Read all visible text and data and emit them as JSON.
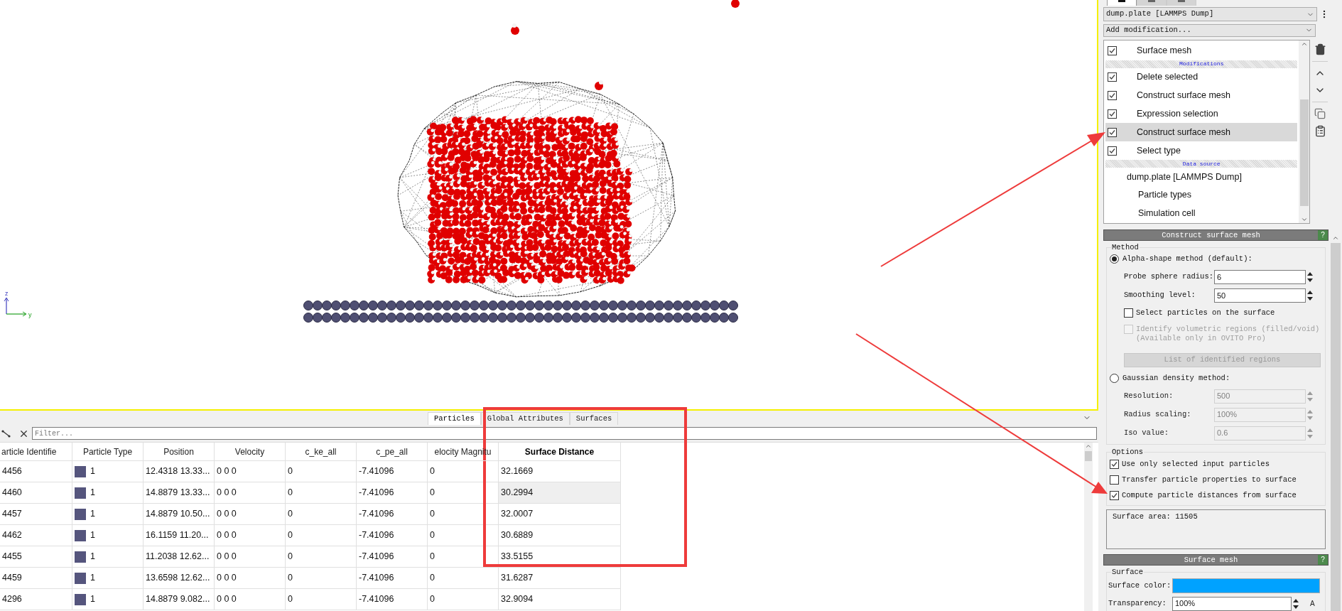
{
  "viewport": {
    "axis_labels": [
      "z",
      "y"
    ]
  },
  "data_inspector": {
    "tabs": [
      {
        "label": "Particles",
        "selected": true
      },
      {
        "label": "Global Attributes",
        "selected": false
      },
      {
        "label": "Surfaces",
        "selected": false
      }
    ],
    "filter": {
      "placeholder": "Filter..."
    },
    "table": {
      "columns": [
        {
          "label": "article Identifie",
          "selected": false
        },
        {
          "label": "Particle Type",
          "selected": false
        },
        {
          "label": "Position",
          "selected": false
        },
        {
          "label": "Velocity",
          "selected": false
        },
        {
          "label": "c_ke_all",
          "selected": false
        },
        {
          "label": "c_pe_all",
          "selected": false
        },
        {
          "label": "elocity Magnitu",
          "selected": false
        },
        {
          "label": "Surface Distance",
          "selected": true
        }
      ],
      "rows": [
        {
          "cells": [
            "4456",
            "1",
            "12.4318 13.33...",
            "0 0 0",
            "0",
            "-7.41096",
            "0",
            "32.1669"
          ],
          "color": "#55557d",
          "selected": false
        },
        {
          "cells": [
            "4460",
            "1",
            "14.8879 13.33...",
            "0 0 0",
            "0",
            "-7.41096",
            "0",
            "30.2994"
          ],
          "color": "#55557d",
          "selected": true
        },
        {
          "cells": [
            "4457",
            "1",
            "14.8879 10.50...",
            "0 0 0",
            "0",
            "-7.41096",
            "0",
            "32.0007"
          ],
          "color": "#55557d",
          "selected": false
        },
        {
          "cells": [
            "4462",
            "1",
            "16.1159 11.20...",
            "0 0 0",
            "0",
            "-7.41096",
            "0",
            "30.6889"
          ],
          "color": "#55557d",
          "selected": false
        },
        {
          "cells": [
            "4455",
            "1",
            "11.2038 12.62...",
            "0 0 0",
            "0",
            "-7.41096",
            "0",
            "33.5155"
          ],
          "color": "#55557d",
          "selected": false
        },
        {
          "cells": [
            "4459",
            "1",
            "13.6598 12.62...",
            "0 0 0",
            "0",
            "-7.41096",
            "0",
            "31.6287"
          ],
          "color": "#55557d",
          "selected": false
        },
        {
          "cells": [
            "4296",
            "1",
            "14.8879 9.082...",
            "0 0 0",
            "0",
            "-7.41096",
            "0",
            "32.9094"
          ],
          "color": "#55557d",
          "selected": false
        }
      ]
    }
  },
  "pipeline": {
    "top_tabs": [
      {
        "selected": true
      },
      {
        "selected": false
      },
      {
        "selected": false
      }
    ],
    "source_dropdown": "dump.plate [LAMMPS Dump]",
    "add_modification": "Add modification...",
    "items": [
      {
        "kind": "entry",
        "label": "Surface mesh",
        "checked": true,
        "selected": false
      },
      {
        "kind": "header",
        "label": "Modifications"
      },
      {
        "kind": "entry",
        "label": "Delete selected",
        "checked": true,
        "selected": false
      },
      {
        "kind": "entry",
        "label": "Construct surface mesh",
        "checked": true,
        "selected": false
      },
      {
        "kind": "entry",
        "label": "Expression selection",
        "checked": true,
        "selected": false
      },
      {
        "kind": "entry",
        "label": "Construct surface mesh",
        "checked": true,
        "selected": true
      },
      {
        "kind": "entry",
        "label": "Select type",
        "checked": true,
        "selected": false
      },
      {
        "kind": "header",
        "label": "Data source"
      },
      {
        "kind": "source",
        "label": "dump.plate [LAMMPS Dump]",
        "selected": false,
        "children": [
          {
            "label": "Particle types",
            "selected": false
          },
          {
            "label": "Simulation cell",
            "selected": false
          }
        ]
      }
    ]
  },
  "modifier_panel": {
    "title": "Construct surface mesh",
    "help": "?",
    "method": {
      "title": "Method",
      "options": [
        {
          "label": "Alpha-shape method (default):",
          "selected": true,
          "fields": [
            {
              "kind": "spinner",
              "label": "Probe sphere radius:",
              "value": "6",
              "disabled": false
            },
            {
              "kind": "spinner",
              "label": "Smoothing level:",
              "value": "50",
              "disabled": false
            },
            {
              "kind": "checkbox",
              "label": "Select particles on the surface",
              "checked": false,
              "disabled": false
            },
            {
              "kind": "checkbox",
              "label": "Identify volumetric regions (filled/void)\n(Available only in OVITO Pro)",
              "checked": false,
              "disabled": true
            },
            {
              "kind": "button",
              "label": "List of identified regions",
              "disabled": true
            }
          ]
        },
        {
          "label": "Gaussian density method:",
          "selected": false,
          "fields": [
            {
              "kind": "spinner",
              "label": "Resolution:",
              "value": "500",
              "disabled": true
            },
            {
              "kind": "spinner",
              "label": "Radius scaling:",
              "value": "100%",
              "disabled": true
            },
            {
              "kind": "spinner",
              "label": "Iso value:",
              "value": "0.6",
              "disabled": true
            }
          ]
        }
      ]
    },
    "options": {
      "title": "Options",
      "items": [
        {
          "label": "Use only selected input particles",
          "checked": true
        },
        {
          "label": "Transfer particle properties to surface",
          "checked": false
        },
        {
          "label": "Compute particle distances from surface",
          "checked": true
        }
      ]
    },
    "status_text": "Surface area: 11505"
  },
  "visual_panel": {
    "title": "Surface mesh",
    "help": "?",
    "group": "Surface",
    "color_label": "Surface color:",
    "color": "#00a2ff",
    "transparency_label": "Transparency:",
    "transparency_value": "100%",
    "key_label": "A"
  }
}
